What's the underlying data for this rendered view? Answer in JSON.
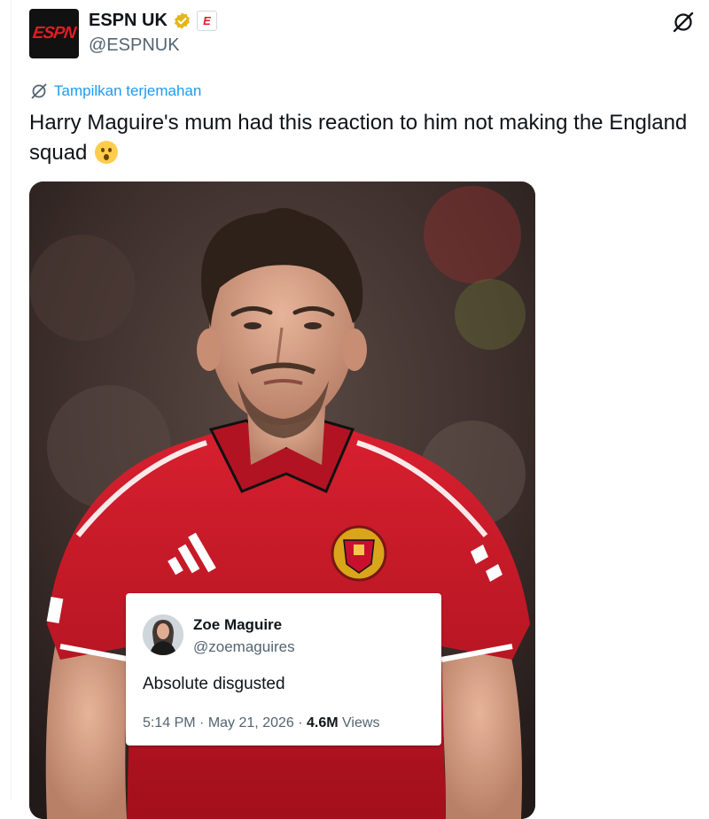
{
  "account": {
    "display_name": "ESPN UK",
    "handle": "@ESPNUK",
    "logo_text": "ESPN",
    "affiliate_badge_text": "E"
  },
  "translate": {
    "label": "Tampilkan terjemahan"
  },
  "tweet": {
    "text": "Harry Maguire's mum had this reaction to him not making the England squad",
    "emoji": "astonished-face"
  },
  "quote_card": {
    "name": "Zoe Maguire",
    "handle": "@zoemaguires",
    "text": "Absolute disgusted",
    "time": "5:14 PM",
    "date": "May 21, 2026",
    "views_count": "4.6M",
    "views_label": "Views"
  },
  "icons": {
    "verified": "verified-badge-icon",
    "grok": "grok-icon",
    "translate": "translate-icon"
  },
  "colors": {
    "link_blue": "#1d9bf0",
    "verified_gold": "#e2b719",
    "espn_red": "#e51b23",
    "shirt_red": "#c8102e"
  }
}
